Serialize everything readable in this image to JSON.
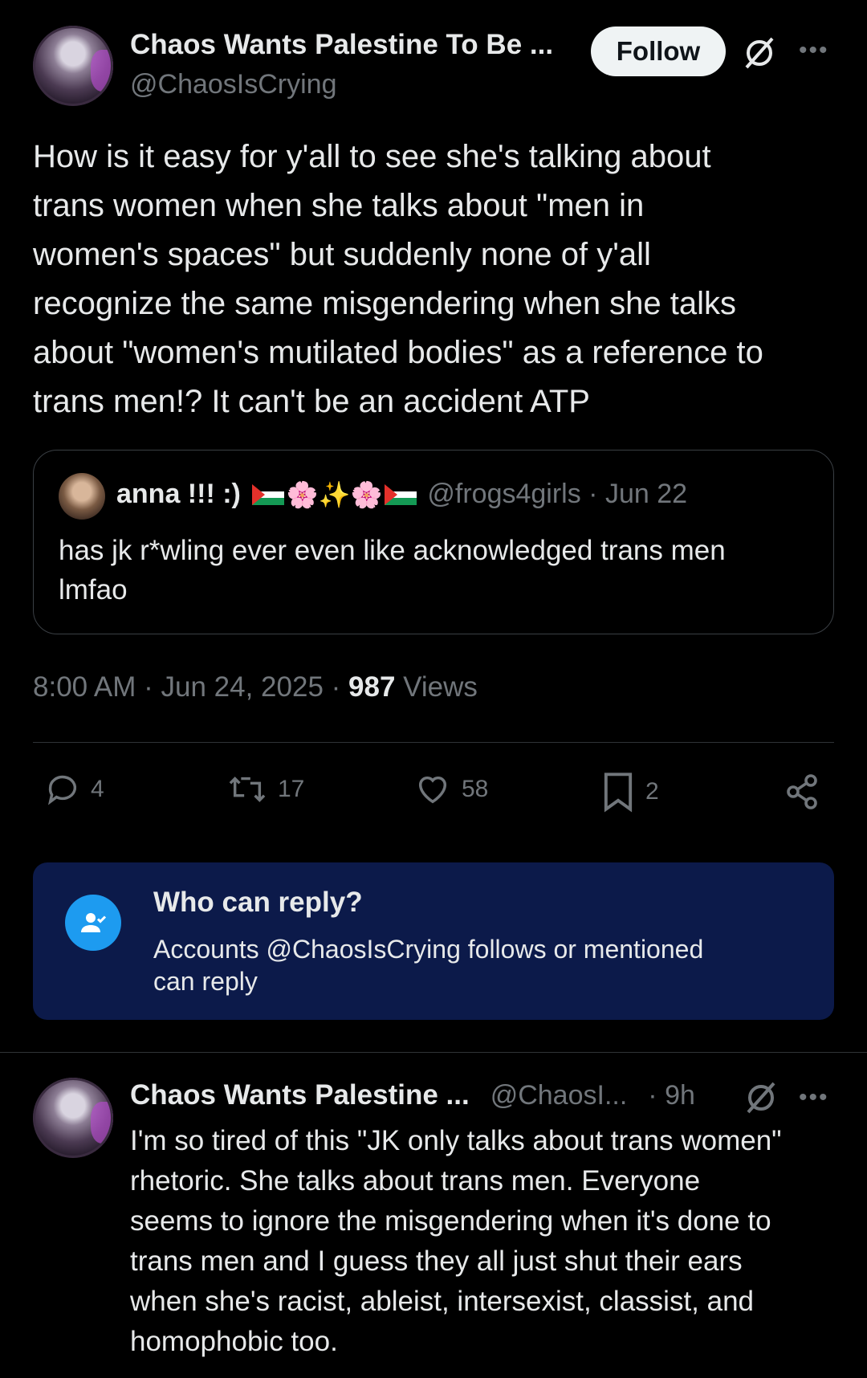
{
  "post": {
    "author_name": "Chaos Wants Palestine To Be ...",
    "author_handle": "@ChaosIsCrying",
    "follow_label": "Follow",
    "more_label": "•••",
    "text": "How is it easy for y'all to see she's talking about trans women when she talks about \"men in women's spaces\" but suddenly none of y'all recognize the same misgendering when she talks about \"women's mutilated bodies\" as a reference to trans men!? It can't be an accident ATP",
    "lines": [
      "How is it easy for y'all to see she's talking about",
      "trans women when she talks about \"men in",
      "women's spaces\" but suddenly none of y'all",
      "recognize the same misgendering when she talks",
      "about \"women's mutilated bodies\" as a reference to",
      "trans men!? It can't be an accident ATP"
    ],
    "timestamp": "8:00 AM · Jun 24, 2025 · ",
    "views_count": "987",
    "views_label": "Views"
  },
  "quote": {
    "name": "anna !!! :)",
    "emojis": "🌸✨🌸",
    "handle_date": "@frogs4girls · Jun 22",
    "line1": "has jk r*wling ever even like acknowledged trans men",
    "line2": "lmfao"
  },
  "actions": {
    "replies": "4",
    "reposts": "17",
    "likes": "58",
    "bookmarks": "2"
  },
  "who_can_reply": {
    "title": "Who can reply?",
    "line1": "Accounts @ChaosIsCrying follows or mentioned",
    "line2": "can reply"
  },
  "reply": {
    "author_name": "Chaos Wants Palestine ...",
    "author_handle": "@ChaosI...",
    "time": "· 9h",
    "more_label": "•••",
    "lines": [
      "I'm so tired of this \"JK only talks about trans women\"",
      "rhetoric. She talks about trans men. Everyone",
      "seems to ignore the misgendering when it's done to",
      "trans men and I guess they all just shut their ears",
      "when she's racist, ableist, intersexist, classist, and",
      "homophobic too."
    ]
  },
  "colors": {
    "background": "#000000",
    "text": "#e7e9ea",
    "muted": "#71767b",
    "accent": "#1d9bf0",
    "reply_box": "#0c1a4a"
  }
}
